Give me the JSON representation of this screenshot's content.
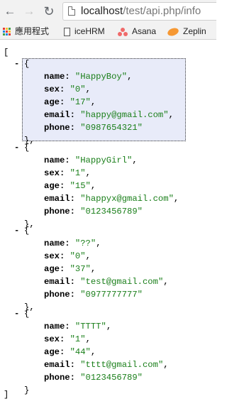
{
  "browser": {
    "back_icon": "←",
    "forward_icon": "→",
    "reload_icon": "↻",
    "url_host": "localhost",
    "url_path": "/test/api.php/info"
  },
  "bookmarks": [
    {
      "icon": "apps-grid-icon",
      "label": "應用程式"
    },
    {
      "icon": "document-icon",
      "label": "iceHRM"
    },
    {
      "icon": "asana-logo-icon",
      "label": "Asana"
    },
    {
      "icon": "zeplin-logo-icon",
      "label": "Zeplin"
    }
  ],
  "json_view": {
    "open_bracket": "[",
    "close_bracket": "]",
    "toggle": "-",
    "obj_open": "{",
    "obj_close": "},",
    "obj_close_last": "}",
    "records": [
      {
        "name": "HappyBoy",
        "sex": "0",
        "age": "17",
        "email": "happy@gmail.com",
        "phone": "0987654321"
      },
      {
        "name": "HappyGirl",
        "sex": "1",
        "age": "15",
        "email": "happyx@gmail.com",
        "phone": "0123456789"
      },
      {
        "name": "??",
        "sex": "0",
        "age": "37",
        "email": "test@gmail.com",
        "phone": "0977777777"
      },
      {
        "name": "TTTT",
        "sex": "1",
        "age": "44",
        "email": "tttt@gmail.com",
        "phone": "0123456789"
      }
    ]
  },
  "colors": {
    "string": "#1a7f1a",
    "selection_bg": "#e8ebf9"
  }
}
